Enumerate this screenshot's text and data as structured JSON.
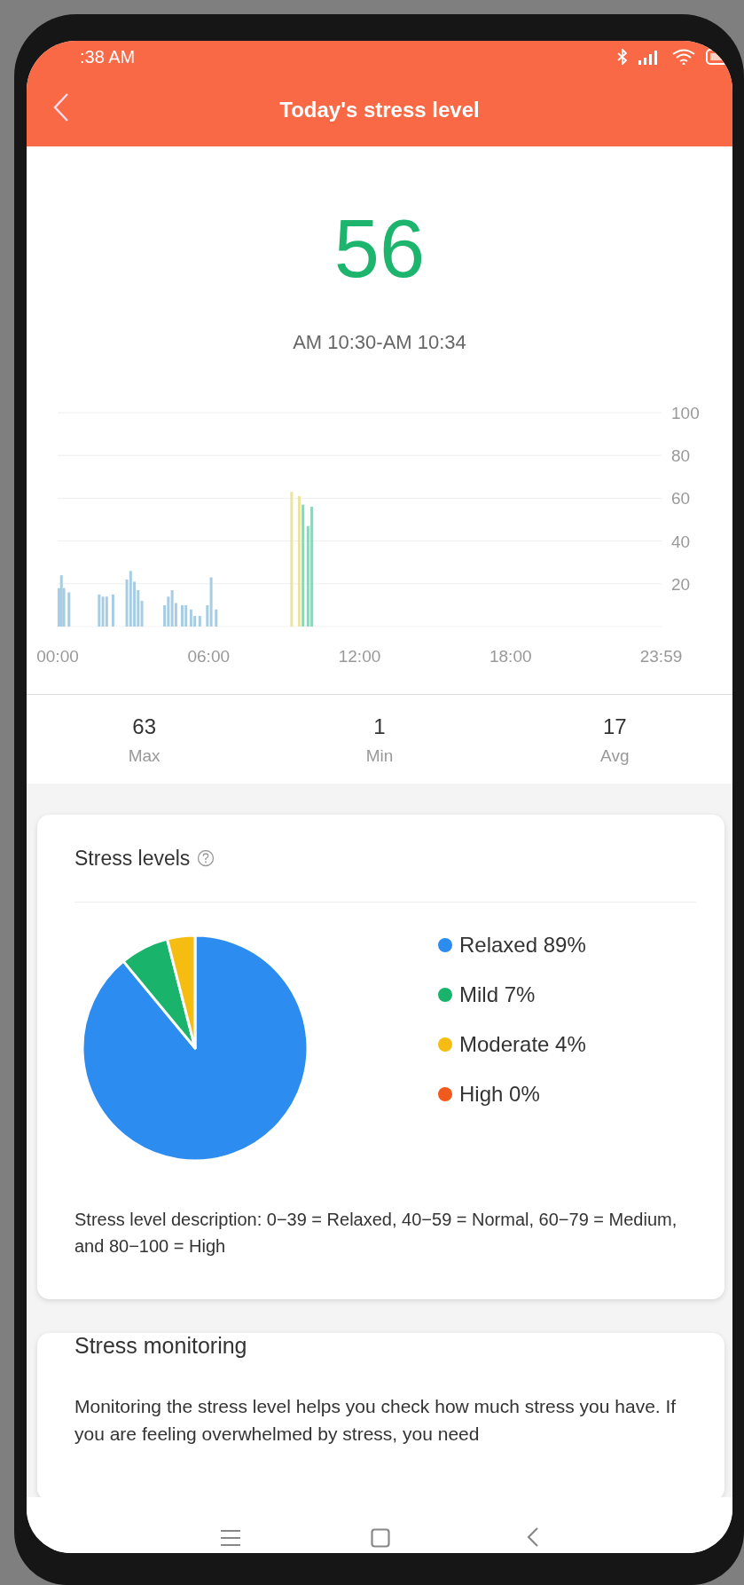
{
  "status_bar": {
    "time": ":38 AM"
  },
  "header": {
    "title": "Today's stress level"
  },
  "current": {
    "value": "56",
    "time_range": "AM 10:30-AM 10:34"
  },
  "chart_data": {
    "type": "bar",
    "x": [
      0.05,
      0.15,
      0.25,
      0.45,
      1.65,
      1.8,
      1.95,
      2.2,
      2.75,
      2.9,
      3.05,
      3.2,
      3.35,
      4.25,
      4.4,
      4.55,
      4.7,
      4.95,
      5.1,
      5.3,
      5.45,
      5.65,
      5.95,
      6.1,
      6.3,
      9.3,
      9.6,
      9.75,
      9.95,
      10.1
    ],
    "stacked": true,
    "grid": true,
    "series": [
      {
        "color": "#a8cde2",
        "values": [
          18,
          24,
          18,
          16,
          15,
          14,
          14,
          15,
          22,
          26,
          21,
          17,
          12,
          10,
          14,
          17,
          11,
          10,
          10,
          8,
          5,
          5,
          10,
          23,
          8,
          0,
          0,
          0,
          0,
          0
        ]
      },
      {
        "color": "#ece49c",
        "values": [
          0,
          0,
          0,
          0,
          0,
          0,
          0,
          0,
          0,
          0,
          0,
          0,
          0,
          0,
          0,
          0,
          0,
          0,
          0,
          0,
          0,
          0,
          0,
          0,
          0,
          63,
          61,
          0,
          0,
          0
        ]
      },
      {
        "color": "#8fd5b9",
        "values": [
          0,
          0,
          0,
          0,
          0,
          0,
          0,
          0,
          0,
          0,
          0,
          0,
          0,
          0,
          0,
          0,
          0,
          0,
          0,
          0,
          0,
          0,
          0,
          0,
          0,
          0,
          0,
          57,
          47,
          56
        ]
      }
    ],
    "xlim": [
      0,
      24
    ],
    "ylim": [
      0,
      100
    ],
    "xticks": [
      {
        "value": 0,
        "label": "00:00"
      },
      {
        "value": 6,
        "label": "06:00"
      },
      {
        "value": 12,
        "label": "12:00"
      },
      {
        "value": 18,
        "label": "18:00"
      },
      {
        "value": 23.983,
        "label": "23:59"
      }
    ],
    "yticks": [
      20,
      40,
      60,
      80,
      100
    ]
  },
  "stats": [
    {
      "value": "63",
      "label": "Max"
    },
    {
      "value": "1",
      "label": "Min"
    },
    {
      "value": "17",
      "label": "Avg"
    }
  ],
  "stress_levels": {
    "title": "Stress levels",
    "chart_data": {
      "type": "pie",
      "values": [
        89,
        7,
        4,
        0
      ]
    },
    "legend": [
      {
        "label": "Relaxed 89%",
        "color": "#2d8cf0"
      },
      {
        "label": "Mild 7%",
        "color": "#19b36b"
      },
      {
        "label": "Moderate 4%",
        "color": "#f5bd12"
      },
      {
        "label": "High 0%",
        "color": "#f15a1d"
      }
    ],
    "description": "Stress level description: 0−39 = Relaxed, 40−59 = Normal, 60−79 = Medium, and 80−100 = High"
  },
  "stress_monitoring": {
    "title": "Stress monitoring",
    "text": "Monitoring the stress level helps you check how much stress you have. If you are feeling overwhelmed by stress, you need"
  }
}
